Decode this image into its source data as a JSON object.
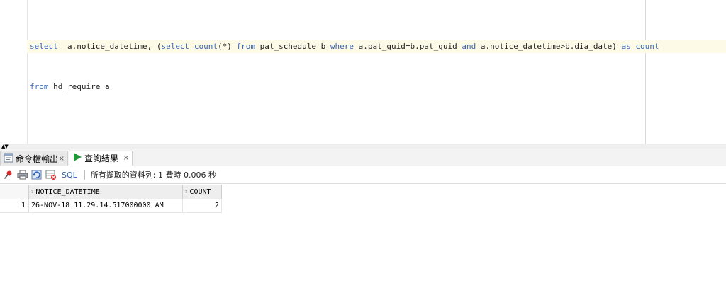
{
  "editor": {
    "lines": [
      [
        {
          "t": "select",
          "k": "kw"
        },
        {
          "t": "  a.notice_datetime, (",
          "k": "id"
        },
        {
          "t": "select",
          "k": "kw"
        },
        {
          "t": " ",
          "k": "id"
        },
        {
          "t": "count",
          "k": "kw"
        },
        {
          "t": "(*) ",
          "k": "id"
        },
        {
          "t": "from",
          "k": "kw"
        },
        {
          "t": " pat_schedule b ",
          "k": "id"
        },
        {
          "t": "where",
          "k": "kw"
        },
        {
          "t": " a.pat_guid=b.pat_guid ",
          "k": "id"
        },
        {
          "t": "and",
          "k": "kw"
        },
        {
          "t": " a.notice_datetime>b.dia_date) ",
          "k": "id"
        },
        {
          "t": "as",
          "k": "kw"
        },
        {
          "t": " ",
          "k": "id"
        },
        {
          "t": "count",
          "k": "kw"
        }
      ],
      [
        {
          "t": "from",
          "k": "kw"
        },
        {
          "t": " hd_require a",
          "k": "id"
        }
      ]
    ]
  },
  "tabs": [
    {
      "label": "命令檔輸出",
      "icon": "script-output-icon",
      "close": "×"
    },
    {
      "label": "查詢結果",
      "icon": "run-green-triangle-icon",
      "close": "×"
    }
  ],
  "toolbar": {
    "sql_label": "SQL",
    "status": "所有擷取的資料列: 1 費時 0.006 秒"
  },
  "grid": {
    "columns": [
      "NOTICE_DATETIME",
      "COUNT"
    ],
    "rows": [
      {
        "num": "1",
        "values": [
          "26-NOV-18 11.29.14.517000000 AM",
          "2"
        ]
      }
    ]
  },
  "colors": {
    "keyword": "#3a67b8",
    "sql_link": "#2f5fa6",
    "run_green": "#1f9a3a",
    "pin_red": "#d22a2a",
    "current_line": "#fdfbe8"
  }
}
